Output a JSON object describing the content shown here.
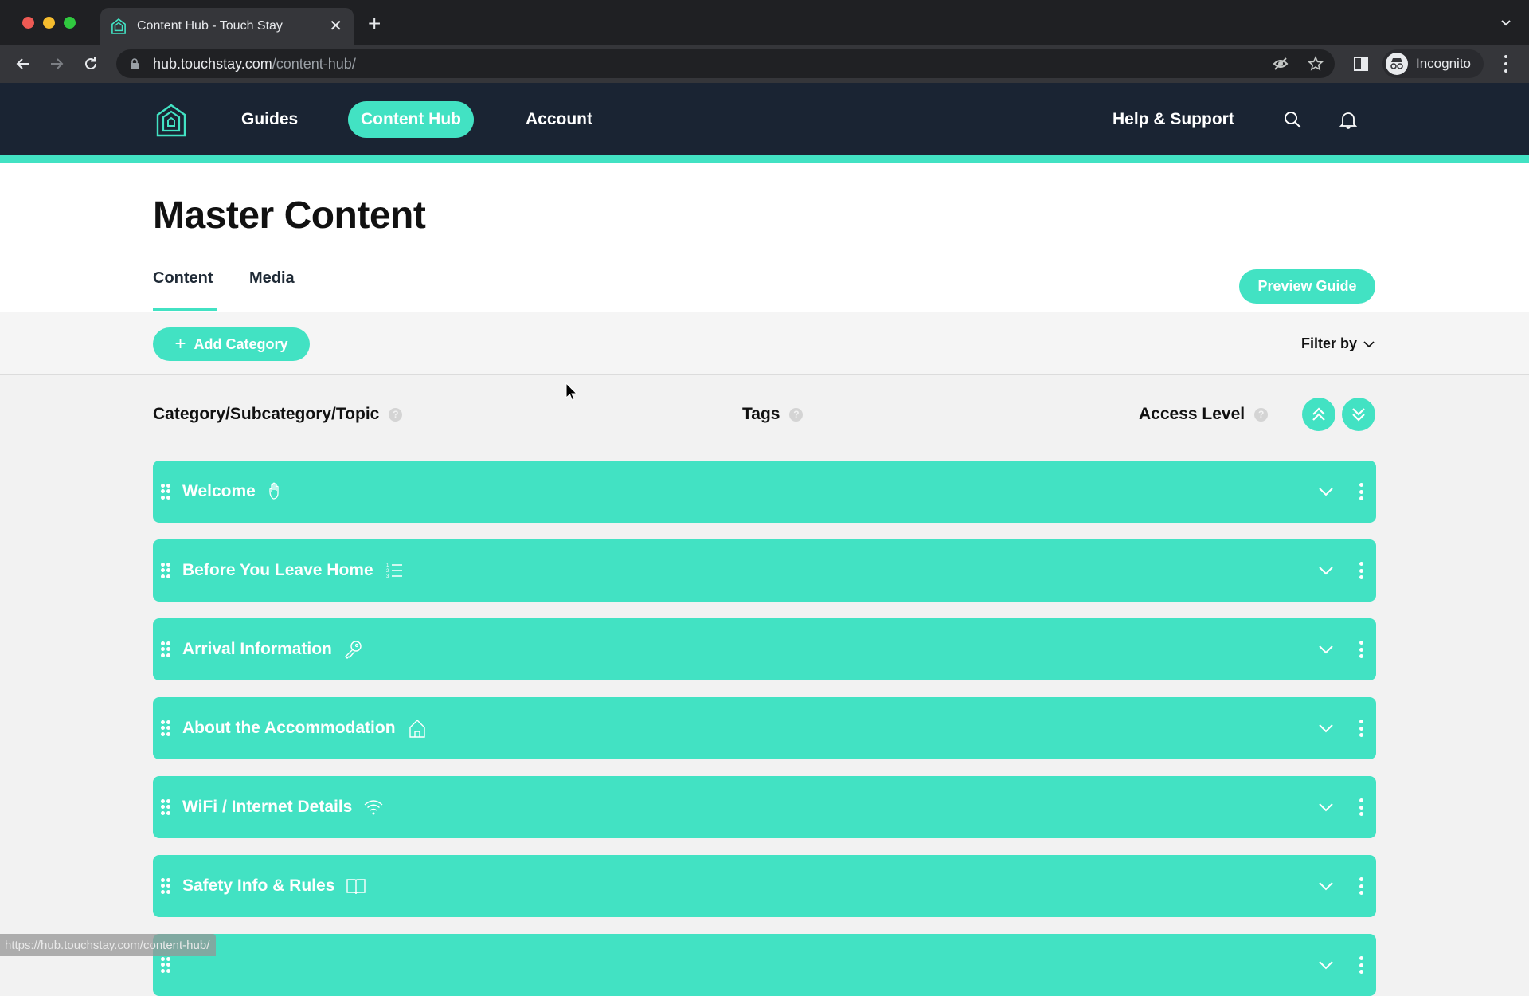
{
  "browser": {
    "tab_title": "Content Hub - Touch Stay",
    "url_host": "hub.touchstay.com",
    "url_path": "/content-hub/",
    "profile_label": "Incognito",
    "status_url": "https://hub.touchstay.com/content-hub/"
  },
  "header": {
    "nav": [
      {
        "label": "Guides",
        "active": false
      },
      {
        "label": "Content Hub",
        "active": true
      },
      {
        "label": "Account",
        "active": false
      }
    ],
    "help_label": "Help & Support"
  },
  "page": {
    "title": "Master Content",
    "tabs": [
      {
        "label": "Content",
        "active": true
      },
      {
        "label": "Media",
        "active": false
      }
    ],
    "preview_button": "Preview Guide",
    "add_category_button": "Add Category",
    "filter_label": "Filter by"
  },
  "columns": {
    "category": "Category/Subcategory/Topic",
    "tags": "Tags",
    "access": "Access Level",
    "help_glyph": "?"
  },
  "categories": [
    {
      "label": "Welcome",
      "icon": "hand-wave-icon"
    },
    {
      "label": "Before You Leave Home",
      "icon": "numbered-list-icon"
    },
    {
      "label": "Arrival Information",
      "icon": "key-icon"
    },
    {
      "label": "About the Accommodation",
      "icon": "house-icon"
    },
    {
      "label": "WiFi / Internet Details",
      "icon": "wifi-icon"
    },
    {
      "label": "Safety Info & Rules",
      "icon": "book-icon"
    },
    {
      "label": "",
      "icon": "partial-row"
    }
  ],
  "colors": {
    "accent": "#42e2c3",
    "header_bg": "#1a2433"
  }
}
